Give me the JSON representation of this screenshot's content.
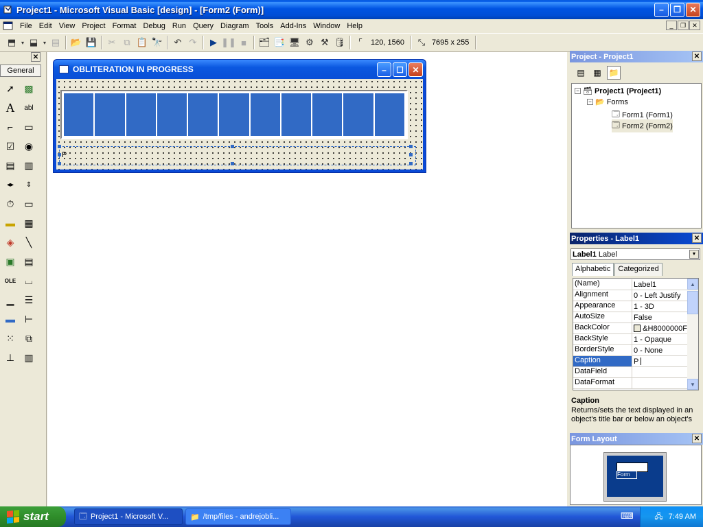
{
  "window": {
    "title": "Project1 - Microsoft Visual Basic [design] - [Form2 (Form)]"
  },
  "menu": [
    "File",
    "Edit",
    "View",
    "Project",
    "Format",
    "Debug",
    "Run",
    "Query",
    "Diagram",
    "Tools",
    "Add-Ins",
    "Window",
    "Help"
  ],
  "toolbar": {
    "position": "120, 1560",
    "size": "7695 x 255"
  },
  "toolbox": {
    "tab_label": "General"
  },
  "form": {
    "caption": "OBLITERATION IN PROGRESS",
    "progress_blocks": 11,
    "label_text": "P"
  },
  "project_explorer": {
    "title": "Project - Project1",
    "root": "Project1 (Project1)",
    "folder": "Forms",
    "items": [
      "Form1 (Form1)",
      "Form2 (Form2)"
    ]
  },
  "properties": {
    "title": "Properties - Label1",
    "object_name": "Label1",
    "object_type": "Label",
    "tabs": [
      "Alphabetic",
      "Categorized"
    ],
    "rows": [
      {
        "name": "(Name)",
        "value": "Label1"
      },
      {
        "name": "Alignment",
        "value": "0 - Left Justify"
      },
      {
        "name": "Appearance",
        "value": "1 - 3D"
      },
      {
        "name": "AutoSize",
        "value": "False"
      },
      {
        "name": "BackColor",
        "value": "&H8000000F"
      },
      {
        "name": "BackStyle",
        "value": "1 - Opaque"
      },
      {
        "name": "BorderStyle",
        "value": "0 - None"
      },
      {
        "name": "Caption",
        "value": "P"
      },
      {
        "name": "DataField",
        "value": ""
      },
      {
        "name": "DataFormat",
        "value": ""
      }
    ],
    "desc_title": "Caption",
    "desc_text": "Returns/sets the text displayed in an object's title bar or below an object's"
  },
  "form_layout": {
    "title": "Form Layout",
    "mini_label": "Form"
  },
  "taskbar": {
    "start": "start",
    "tasks": [
      "Project1 - Microsoft V...",
      "/tmp/files - andrejobli..."
    ],
    "clock": "7:49 AM"
  },
  "colors": {
    "accent": "#316ac5",
    "titlebar": "#0054e3",
    "start": "#2f8d2a"
  }
}
